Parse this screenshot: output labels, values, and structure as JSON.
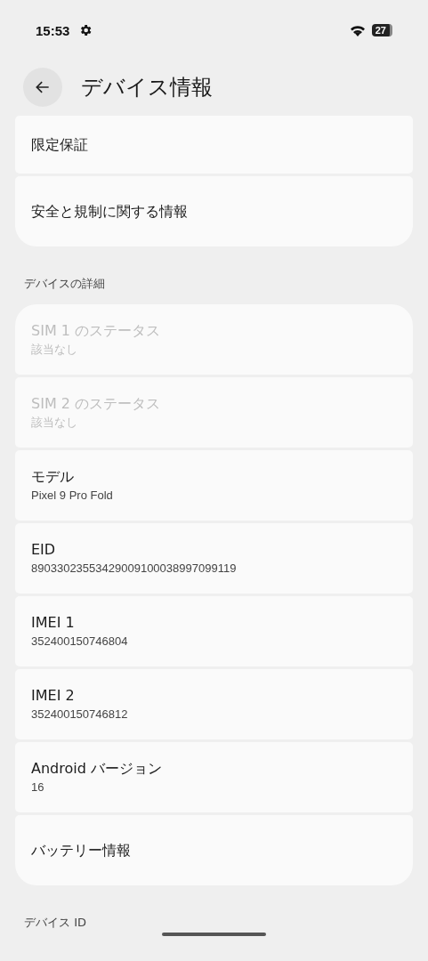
{
  "status_bar": {
    "time": "15:53",
    "battery": "27"
  },
  "app_bar": {
    "title": "デバイス情報"
  },
  "groups": [
    {
      "items": [
        {
          "title": "限定保証",
          "disabled": false
        },
        {
          "title": "安全と規制に関する情報",
          "disabled": false
        }
      ]
    },
    {
      "header": "デバイスの詳細",
      "items": [
        {
          "title": "SIM 1 のステータス",
          "summary": "該当なし",
          "disabled": true
        },
        {
          "title": "SIM 2 のステータス",
          "summary": "該当なし",
          "disabled": true
        },
        {
          "title": "モデル",
          "summary": "Pixel 9 Pro Fold",
          "disabled": false
        },
        {
          "title": "EID",
          "summary": "89033023553429009100038997099119",
          "disabled": false
        },
        {
          "title": "IMEI 1",
          "summary": "352400150746804",
          "disabled": false
        },
        {
          "title": "IMEI 2",
          "summary": "352400150746812",
          "disabled": false
        },
        {
          "title": "Android バージョン",
          "summary": "16",
          "disabled": false
        },
        {
          "title": "バッテリー情報",
          "disabled": false
        }
      ]
    },
    {
      "header": "デバイス ID"
    }
  ]
}
